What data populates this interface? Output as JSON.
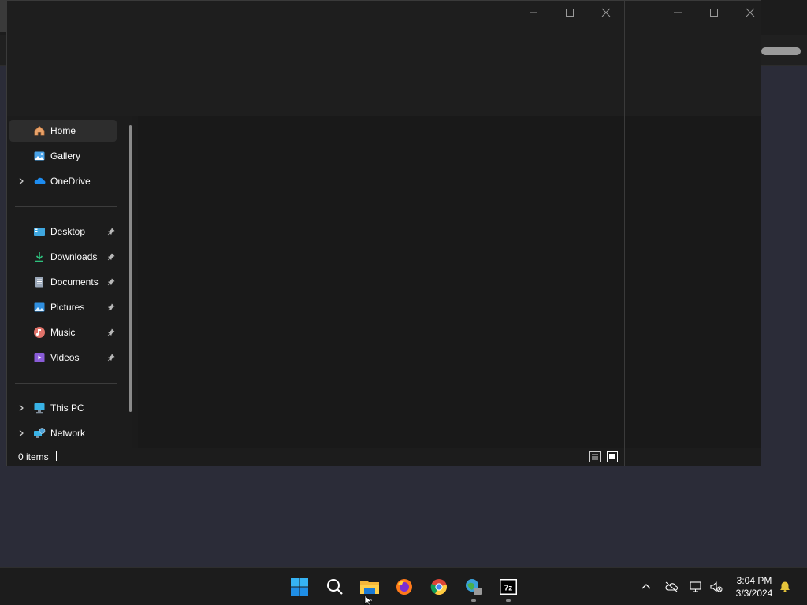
{
  "nav": {
    "home": "Home",
    "gallery": "Gallery",
    "onedrive": "OneDrive",
    "desktop": "Desktop",
    "downloads": "Downloads",
    "documents": "Documents",
    "pictures": "Pictures",
    "music": "Music",
    "videos": "Videos",
    "this_pc": "This PC",
    "network": "Network"
  },
  "status": {
    "items": "0 items"
  },
  "clock": {
    "time": "3:04 PM",
    "date": "3/3/2024"
  },
  "colors": {
    "accent": "#0078d4",
    "window_bg": "#1b1b1b",
    "taskbar_bg": "#1c1c1c"
  },
  "taskbar": {
    "apps": [
      "start-icon",
      "search-icon",
      "file-explorer-icon",
      "firefox-icon",
      "chrome-icon",
      "network-globe-app-icon",
      "7zip-icon"
    ]
  },
  "tray": [
    "chevron-up-icon",
    "onedrive-offline-icon",
    "network-icon",
    "volume-muted-icon",
    "notification-bell-icon"
  ]
}
